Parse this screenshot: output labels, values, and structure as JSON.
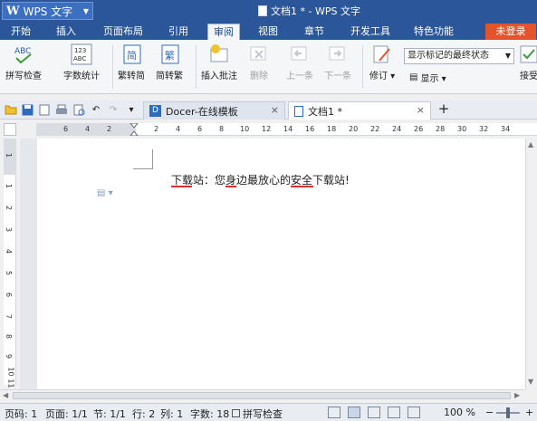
{
  "app": {
    "name": "WPS 文字",
    "logo": "W",
    "window_title": "文档1 * - WPS 文字"
  },
  "menu_tabs": [
    {
      "label": "开始"
    },
    {
      "label": "插入"
    },
    {
      "label": "页面布局"
    },
    {
      "label": "引用"
    },
    {
      "label": "审阅"
    },
    {
      "label": "视图"
    },
    {
      "label": "章节"
    },
    {
      "label": "开发工具"
    },
    {
      "label": "特色功能"
    }
  ],
  "login_label": "未登录",
  "ribbon": {
    "spell_check": "拼写检查",
    "word_count": "字数统计",
    "to_traditional": "繁转简",
    "to_simplified": "简转繁",
    "insert_comment": "插入批注",
    "delete": "删除",
    "prev": "上一条",
    "next": "下一条",
    "revise": "修订",
    "display": "显示",
    "accept": "接受",
    "abc_label": "ABC",
    "count_label": "123",
    "count_sub": "ABC",
    "trad_char": "繁",
    "simp_char": "简",
    "status_select": "显示标记的最终状态"
  },
  "doc_tabs": [
    {
      "label": "Docer-在线模板",
      "icon": "D",
      "close": "×"
    },
    {
      "label": "文档1 *",
      "close": "×"
    }
  ],
  "new_tab": "+",
  "ruler_ticks": [
    "6",
    "4",
    "2",
    "2",
    "4",
    "6",
    "8",
    "10",
    "12",
    "14",
    "16",
    "18",
    "20",
    "22",
    "24",
    "26",
    "28",
    "30",
    "32",
    "34"
  ],
  "vruler_ticks": [
    "1",
    "1",
    "2",
    "3",
    "4",
    "5",
    "6",
    "7",
    "8",
    "9",
    "10",
    "11"
  ],
  "document": {
    "text": "下载站：您身边最放心的安全下载站!"
  },
  "status": {
    "page_code": "页码: 1",
    "pages": "页面: 1/1",
    "section": "节: 1/1",
    "row": "行: 2",
    "col": "列: 1",
    "words": "字数: 18",
    "spell_check": "拼写检查",
    "zoom": "100 %"
  },
  "colors": {
    "brand_blue": "#2b579a",
    "login_orange": "#e2542b",
    "spell_red": "#e03030"
  }
}
